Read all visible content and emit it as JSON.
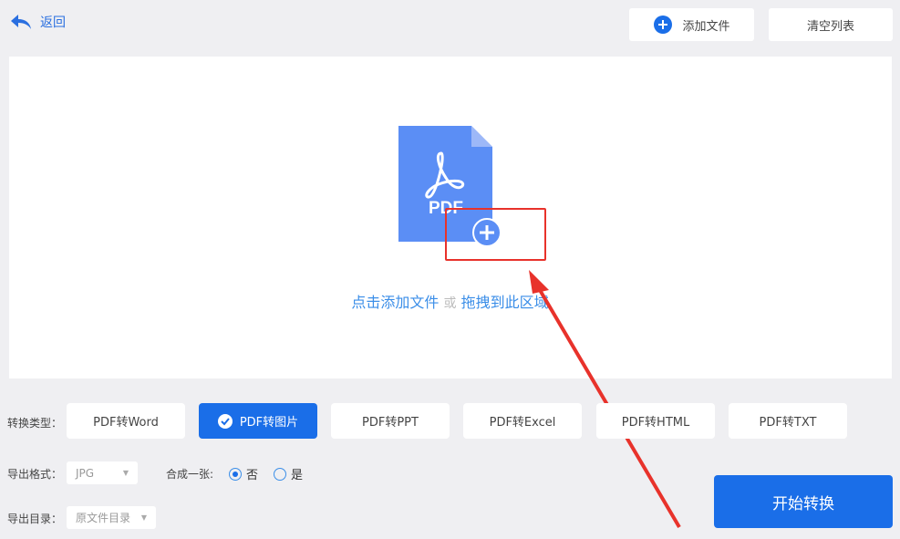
{
  "header": {
    "back_label": "返回",
    "add_file_label": "添加文件",
    "clear_list_label": "清空列表"
  },
  "dropzone": {
    "icon_text": "PDF",
    "click_add": "点击添加文件",
    "or": "或",
    "drag_here": "拖拽到此区域"
  },
  "options": {
    "type_label": "转换类型：",
    "types": [
      {
        "label": "PDF转Word"
      },
      {
        "label": "PDF转图片",
        "selected": true
      },
      {
        "label": "PDF转PPT"
      },
      {
        "label": "PDF转Excel"
      },
      {
        "label": "PDF转HTML"
      },
      {
        "label": "PDF转TXT"
      }
    ],
    "format_label": "导出格式：",
    "format_value": "JPG",
    "merge_label": "合成一张:",
    "merge_no": "否",
    "merge_yes": "是",
    "merge_selected": "否",
    "dir_label": "导出目录：",
    "dir_value": "原文件目录"
  },
  "start_label": "开始转换",
  "colors": {
    "accent": "#1a6ee8",
    "annotation": "#e8322b"
  }
}
